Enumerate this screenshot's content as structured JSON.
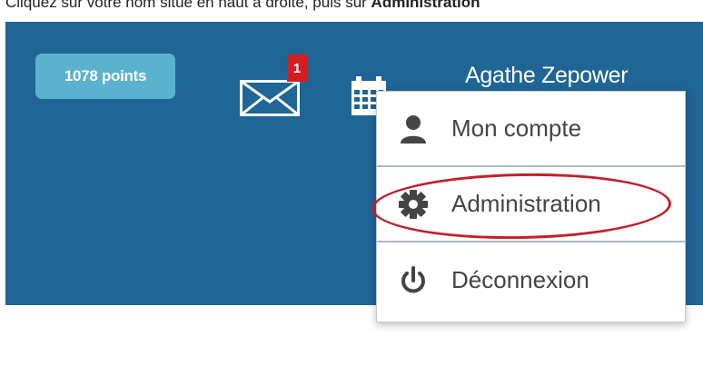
{
  "instruction": {
    "text_before": "Cliquez sur votre nom situé en haut à droite, puis sur ",
    "text_bold": "Administration"
  },
  "header": {
    "points_badge": "1078 points",
    "mail_unread_count": "1",
    "user_name": "Agathe Zepower",
    "icons": {
      "mail": "mail-icon",
      "calendar": "calendar-icon"
    }
  },
  "dropdown": {
    "items": [
      {
        "label": "Mon compte",
        "icon": "user-icon"
      },
      {
        "label": "Administration",
        "icon": "gear-icon",
        "highlighted": true
      },
      {
        "label": "Déconnexion",
        "icon": "power-icon"
      }
    ]
  },
  "colors": {
    "header_bg": "#1f6595",
    "badge_bg": "#5ab2cf",
    "notification_red": "#d11f1f",
    "highlight_red": "#c0212b"
  }
}
